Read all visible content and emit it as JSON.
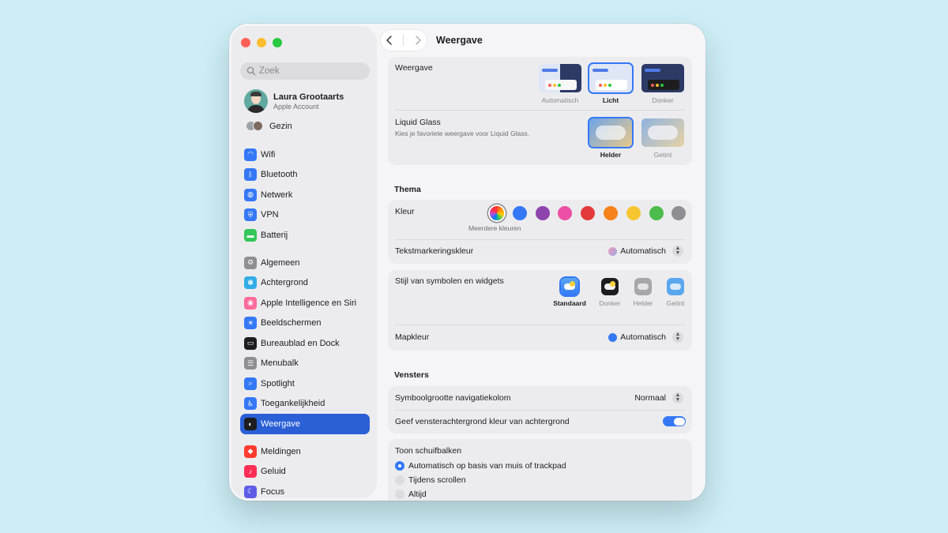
{
  "sidebar": {
    "search_placeholder": "Zoek",
    "account": {
      "name": "Laura Grootaarts",
      "subtitle": "Apple Account"
    },
    "family_label": "Gezin",
    "groups": [
      [
        {
          "label": "Wifi",
          "icon": "wifi-icon",
          "color": "#3478f6"
        },
        {
          "label": "Bluetooth",
          "icon": "bluetooth-icon",
          "color": "#3478f6"
        },
        {
          "label": "Netwerk",
          "icon": "network-icon",
          "color": "#3478f6"
        },
        {
          "label": "VPN",
          "icon": "vpn-icon",
          "color": "#3478f6"
        },
        {
          "label": "Batterij",
          "icon": "battery-icon",
          "color": "#34c759"
        }
      ],
      [
        {
          "label": "Algemeen",
          "icon": "gear-icon",
          "color": "#8e8e93"
        },
        {
          "label": "Achtergrond",
          "icon": "wallpaper-icon",
          "color": "#32ade6"
        },
        {
          "label": "Apple Intelligence en Siri",
          "icon": "siri-icon",
          "color": "#ff6b9a"
        },
        {
          "label": "Beeldschermen",
          "icon": "display-icon",
          "color": "#3478f6"
        },
        {
          "label": "Bureaublad en Dock",
          "icon": "dock-icon",
          "color": "#1d1d1f"
        },
        {
          "label": "Menubalk",
          "icon": "menubar-icon",
          "color": "#8e8e93"
        },
        {
          "label": "Spotlight",
          "icon": "spotlight-icon",
          "color": "#3478f6"
        },
        {
          "label": "Toegankelijkheid",
          "icon": "accessibility-icon",
          "color": "#3478f6"
        },
        {
          "label": "Weergave",
          "icon": "appearance-icon",
          "color": "#1d1d1f",
          "active": true
        }
      ],
      [
        {
          "label": "Meldingen",
          "icon": "notifications-icon",
          "color": "#ff3b30"
        },
        {
          "label": "Geluid",
          "icon": "sound-icon",
          "color": "#ff2d55"
        },
        {
          "label": "Focus",
          "icon": "moon-icon",
          "color": "#5e5ce6"
        }
      ]
    ]
  },
  "header": {
    "title": "Weergave"
  },
  "appearance": {
    "label": "Weergave",
    "options": [
      "Automatisch",
      "Licht",
      "Donker"
    ],
    "selected": "Licht"
  },
  "liquid_glass": {
    "label": "Liquid Glass",
    "description": "Kies je favoriete weergave voor Liquid Glass.",
    "options": [
      "Helder",
      "Getint"
    ],
    "selected": "Helder"
  },
  "theme": {
    "section_title": "Thema",
    "color_label": "Kleur",
    "color_caption": "Meerdere kleuren",
    "colors": [
      "multicolor",
      "#3478f6",
      "#8e44ad",
      "#ec4fa6",
      "#e5383b",
      "#f7821b",
      "#f6c530",
      "#4cbc4c",
      "#8e8e93"
    ],
    "highlight_label": "Tekstmarkeringskleur",
    "highlight_value": "Automatisch",
    "widget_label": "Stijl van symbolen en widgets",
    "widget_options": [
      "Standaard",
      "Donker",
      "Helder",
      "Getint"
    ],
    "widget_selected": "Standaard",
    "folder_label": "Mapkleur",
    "folder_value": "Automatisch"
  },
  "windows": {
    "section_title": "Vensters",
    "sidebar_icon_label": "Symboolgrootte navigatiekolom",
    "sidebar_icon_value": "Normaal",
    "tint_label": "Geef vensterachtergrond kleur van achtergrond",
    "tint_enabled": true,
    "scrollbars_label": "Toon schuifbalken",
    "scrollbar_options": [
      "Automatisch op basis van muis of trackpad",
      "Tijdens scrollen",
      "Altijd"
    ],
    "scrollbar_selected": "Automatisch op basis van muis of trackpad"
  }
}
